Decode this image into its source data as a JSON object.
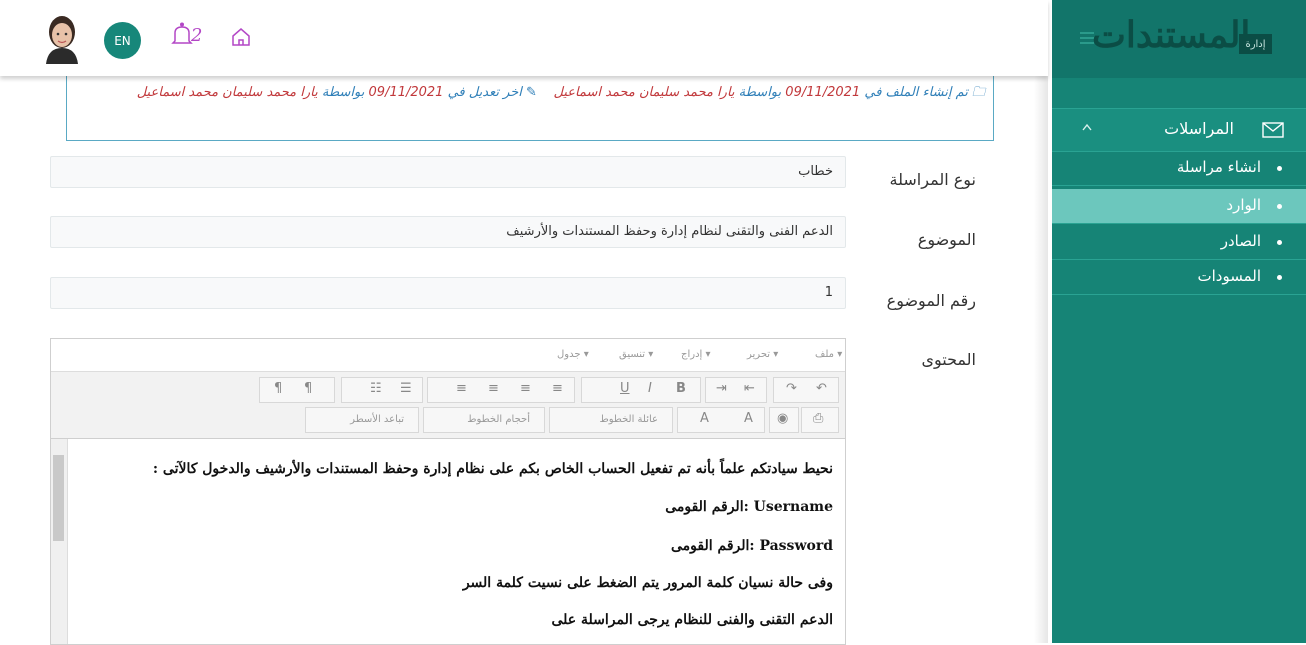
{
  "header": {
    "lang_label": "EN",
    "notification_count": "2"
  },
  "sidebar": {
    "logo_text": "المستندات",
    "logo_badge": "إدارة",
    "section_label": "المراسلات",
    "items": [
      {
        "label": "انشاء مراسلة",
        "active": false
      },
      {
        "label": "الوارد",
        "active": true
      },
      {
        "label": "الصادر",
        "active": false
      },
      {
        "label": "المسودات",
        "active": false
      }
    ]
  },
  "info": {
    "created_prefix": "تم إنشاء الملف في",
    "created_date": "09/11/2021",
    "created_by_word": "بواسطة",
    "created_by": "يارا محمد سليمان محمد اسماعيل",
    "modified_prefix": "اخر تعديل في",
    "modified_date": "09/11/2021",
    "modified_by_word": "بواسطة",
    "modified_by": "يارا محمد سليمان محمد اسماعيل"
  },
  "form": {
    "type_label": "نوع المراسلة",
    "type_value": "خطاب",
    "subject_label": "الموضوع",
    "subject_value": "الدعم الفنى والتقنى لنظام إدارة وحفظ المستندات والأرشيف",
    "number_label": "رقم الموضوع",
    "number_value": "1",
    "content_label": "المحتوى"
  },
  "editor": {
    "menus": [
      "ملف ▾",
      "تحرير ▾",
      "إدراج ▾",
      "تنسيق ▾",
      "جدول ▾"
    ],
    "font_family": "عائلة الخطوط",
    "font_size": "أحجام الخطوط",
    "line_height": "تباعد الأسطر",
    "lines": [
      "نحيط سيادتكم علماً بأنه تم تفعيل الحساب الخاص بكم على نظام إدارة وحفظ المستندات والأرشيف والدخول كالآتى :",
      "Username   :الرقم القومى",
      "Password   :الرقم القومى",
      "وفى حالة نسيان كلمة المرور  يتم الضغط على نسيت كلمة السر",
      "الدعم التقنى والفنى للنظام يرجى المراسلة على"
    ]
  },
  "colors": {
    "sidebar": "#168476",
    "sidebar_active": "#6cc7bd",
    "accent": "#17877a",
    "info_red": "#c1383b",
    "info_blue": "#2f7fb8"
  }
}
